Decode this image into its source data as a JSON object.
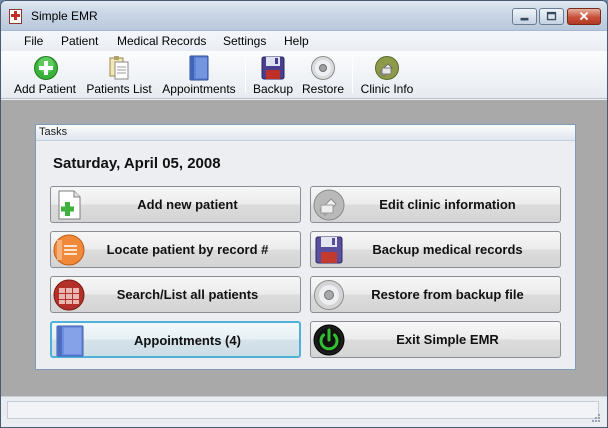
{
  "window": {
    "title": "Simple EMR",
    "icons": [
      "app-icon",
      "minimize-icon",
      "maximize-icon",
      "close-icon"
    ]
  },
  "menu": {
    "items": [
      "File",
      "Patient",
      "Medical Records",
      "Settings",
      "Help"
    ]
  },
  "toolbar": {
    "buttons": [
      {
        "label": "Add Patient",
        "icon": "add-icon"
      },
      {
        "label": "Patients List",
        "icon": "clipboard-icon"
      },
      {
        "label": "Appointments",
        "icon": "book-icon"
      },
      {
        "label": "Backup",
        "icon": "floppy-icon"
      },
      {
        "label": "Restore",
        "icon": "disc-icon"
      },
      {
        "label": "Clinic Info",
        "icon": "clinic-icon"
      }
    ]
  },
  "tasks": {
    "header": "Tasks",
    "date": "Saturday, April 05, 2008",
    "buttons": [
      {
        "label": "Add new patient",
        "icon": "new-document-icon"
      },
      {
        "label": "Edit clinic information",
        "icon": "clinic-icon"
      },
      {
        "label": "Locate patient by record #",
        "icon": "record-icon"
      },
      {
        "label": "Backup medical records",
        "icon": "floppy-icon"
      },
      {
        "label": "Search/List all patients",
        "icon": "patients-grid-icon"
      },
      {
        "label": "Restore from backup file",
        "icon": "disc-icon"
      },
      {
        "label": "Appointments (4)",
        "icon": "book-icon"
      },
      {
        "label": "Exit Simple EMR",
        "icon": "power-icon"
      }
    ]
  },
  "colors": {
    "accent": "#4fb0d9",
    "content_background": "#a9a9a9",
    "power_green": "#2fbf2f"
  }
}
